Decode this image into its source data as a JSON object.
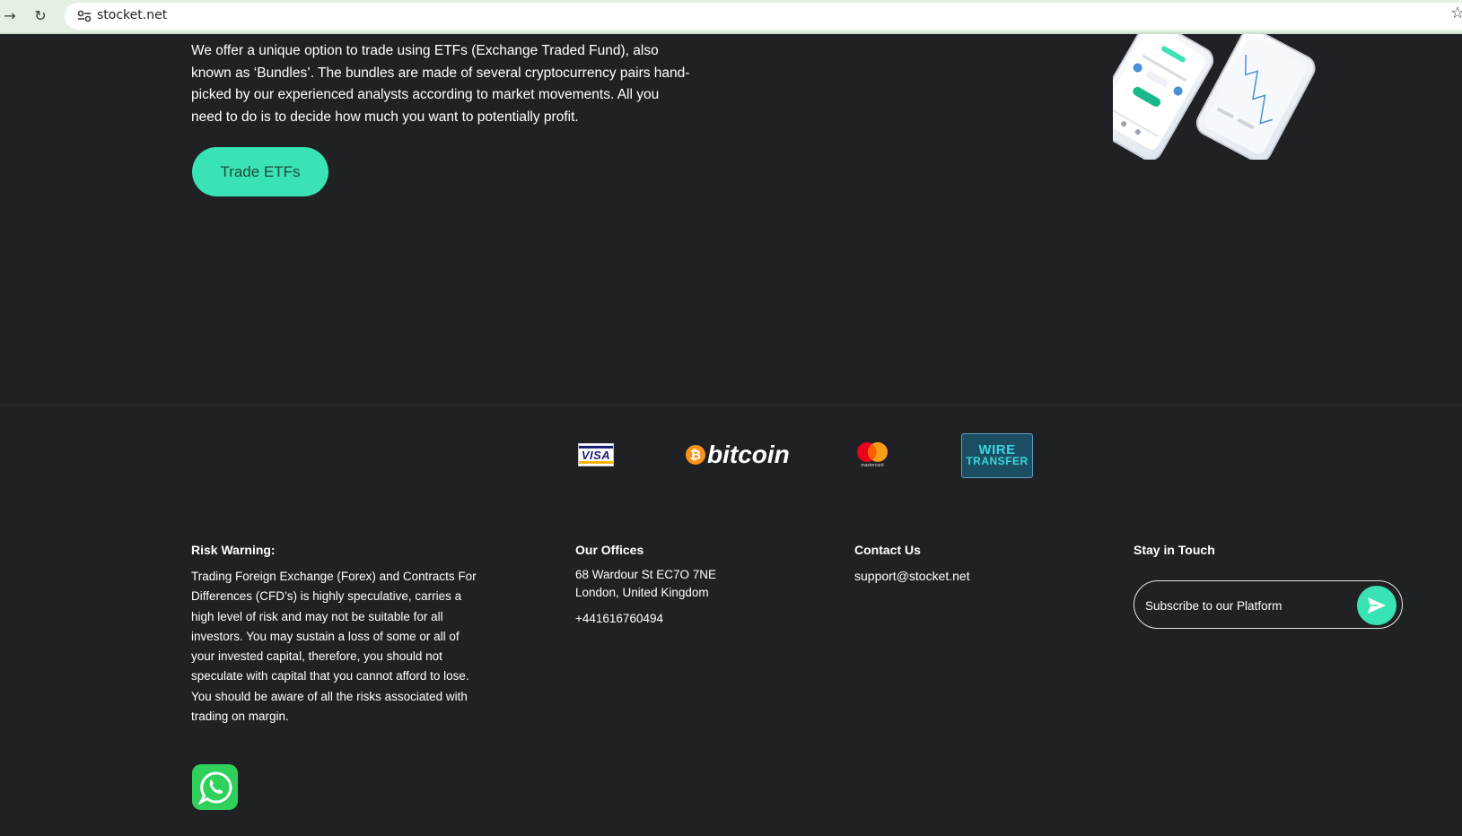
{
  "browser": {
    "url": "stocket.net",
    "icons": [
      "forward-icon",
      "reload-icon",
      "site-settings-icon",
      "bookmark-star-icon"
    ]
  },
  "hero": {
    "paragraph": "We offer a unique option to trade using ETFs (Exchange Traded Fund), also known as ‘Bundles’. The bundles are made of several cryptocurrency pairs hand-picked by our experienced analysts according to market movements. All you need to do is to decide how much you want to potentially profit.",
    "cta_label": "Trade ETFs",
    "accent_color": "#3ae3b3"
  },
  "payments": {
    "visa": "VISA",
    "bitcoin_symbol": "₿",
    "bitcoin": "bitcoin",
    "mastercard": "mastercard",
    "wire_line1": "WIRE",
    "wire_line2": "TRANSFER"
  },
  "footer": {
    "risk": {
      "heading": "Risk Warning:",
      "text": "Trading Foreign Exchange (Forex) and Contracts For Differences (CFD’s) is highly speculative, carries a high level of risk and may not be suitable for all investors. You may sustain a loss of some or all of your invested capital, therefore, you should not speculate with capital that you cannot afford to lose. You should be aware of all the risks associated with trading on margin."
    },
    "offices": {
      "heading": "Our Offices",
      "address_line1": "68 Wardour St EC7O 7NE",
      "address_line2": "London, United Kingdom",
      "phone": "+441616760494"
    },
    "contact": {
      "heading": "Contact Us",
      "email": "support@stocket.net"
    },
    "stay_in_touch": {
      "heading": "Stay in Touch",
      "placeholder": "Subscribe to our Platform"
    }
  }
}
